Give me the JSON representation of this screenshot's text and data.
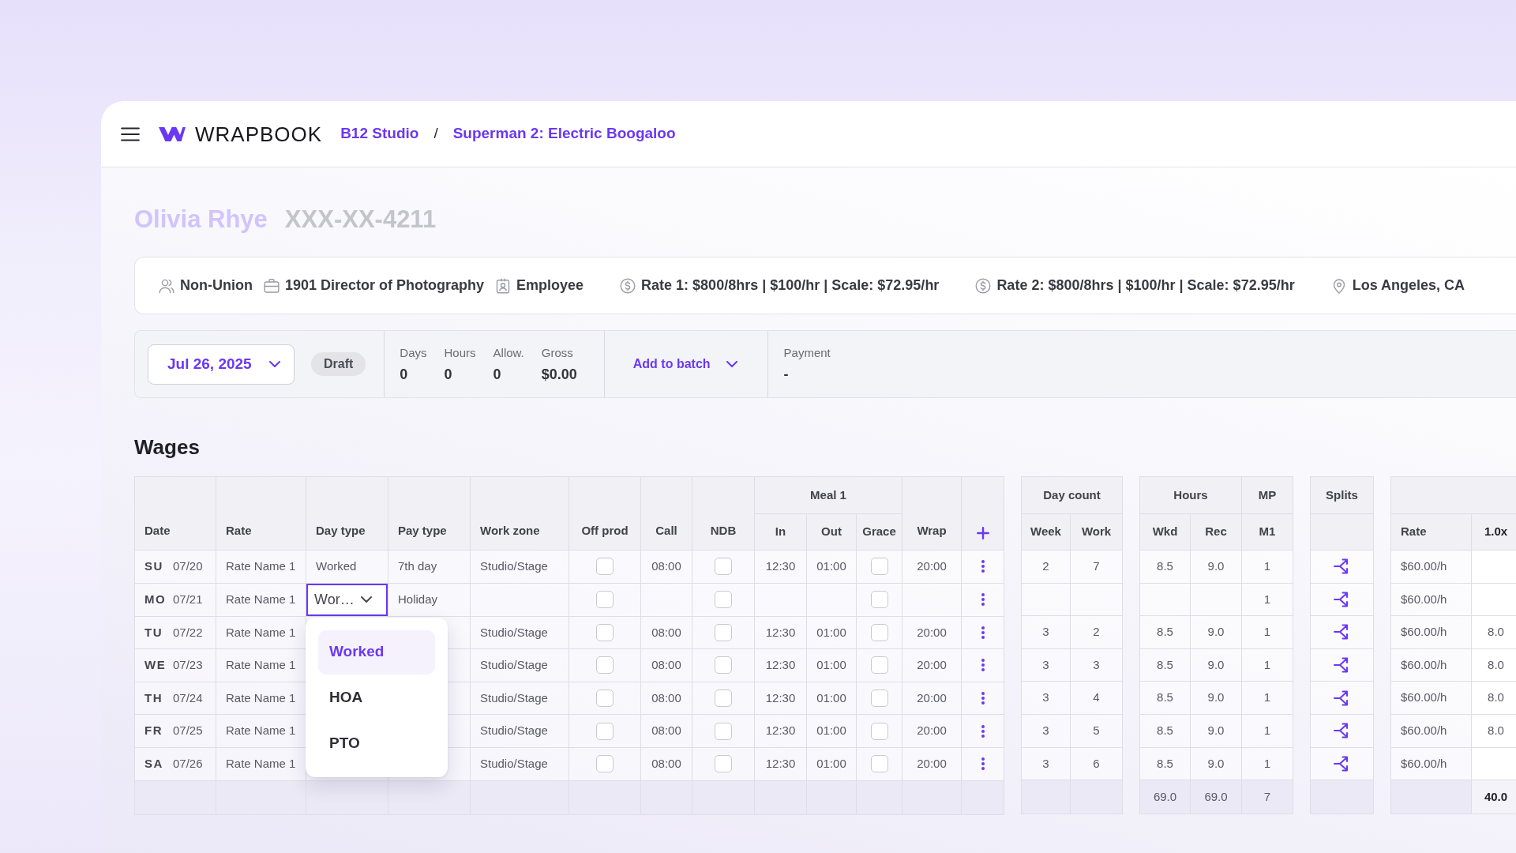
{
  "navbar": {
    "brand": "WRAPBOOK",
    "breadcrumbs": [
      {
        "label": "B12 Studio"
      },
      {
        "label": "Superman 2: Electric Boogaloo"
      }
    ],
    "separator": "/"
  },
  "employee": {
    "name": "Olivia Rhye",
    "ssn": "XXX-XX-4211"
  },
  "details": [
    {
      "kind": "union",
      "text": "Non-Union"
    },
    {
      "kind": "position",
      "text": "1901 Director of Photography"
    },
    {
      "kind": "worker_type",
      "text": "Employee"
    },
    {
      "kind": "rate",
      "text": "Rate 1: $800/8hrs | $100/hr | Scale: $72.95/hr"
    },
    {
      "kind": "rate",
      "text": "Rate 2: $800/8hrs | $100/hr | Scale: $72.95/hr"
    },
    {
      "kind": "location",
      "text": "Los Angeles, CA"
    }
  ],
  "timecard": {
    "date": "Jul 26, 2025",
    "status": "Draft",
    "stats": [
      {
        "label": "Days",
        "value": "0"
      },
      {
        "label": "Hours",
        "value": "0"
      },
      {
        "label": "Allow.",
        "value": "0"
      },
      {
        "label": "Gross",
        "value": "$0.00"
      }
    ],
    "batch_button": "Add to batch",
    "payment": {
      "label": "Payment",
      "value": "-"
    }
  },
  "wages": {
    "title": "Wages",
    "tables": [
      {
        "header": [
          {
            "kind": "date",
            "label": "Date"
          },
          {
            "kind": "text",
            "label": "Rate"
          },
          {
            "kind": "select",
            "label": "Day type"
          },
          {
            "kind": "text",
            "label": "Pay type"
          },
          {
            "kind": "text",
            "label": "Work zone"
          },
          {
            "kind": "checkbox",
            "label": "Off prod"
          },
          {
            "kind": "time",
            "label": "Call"
          },
          {
            "kind": "checkbox",
            "label": "NDB"
          },
          {
            "kind": "group",
            "label": "Meal 1",
            "columns": [
              {
                "kind": "time",
                "label": "In"
              },
              {
                "kind": "time",
                "label": "Out"
              },
              {
                "kind": "checkbox",
                "label": "Grace"
              }
            ]
          },
          {
            "kind": "time",
            "label": "Wrap"
          },
          {
            "kind": "actions"
          }
        ],
        "rows": [
          [
            {
              "day": "SU",
              "date": "07/20"
            },
            "Rate Name 1",
            {
              "value": "Worked",
              "open": false
            },
            "7th day",
            "Studio/Stage",
            {
              "checked": false
            },
            "08:00",
            {
              "checked": false
            },
            "12:30",
            "01:00",
            {
              "checked": false
            },
            "20:00",
            null
          ],
          [
            {
              "day": "MO",
              "date": "07/21"
            },
            "Rate Name 1",
            {
              "value": "Wor…",
              "open": true,
              "options": [
                {
                  "label": "Worked",
                  "selected": true
                },
                {
                  "label": "HOA",
                  "selected": false
                },
                {
                  "label": "PTO",
                  "selected": false
                }
              ]
            },
            "Holiday",
            null,
            {
              "checked": false
            },
            null,
            {
              "checked": false
            },
            null,
            null,
            {
              "checked": false
            },
            null,
            null
          ],
          [
            {
              "day": "TU",
              "date": "07/22"
            },
            "Rate Name 1",
            null,
            null,
            "Studio/Stage",
            {
              "checked": false
            },
            "08:00",
            {
              "checked": false
            },
            "12:30",
            "01:00",
            {
              "checked": false
            },
            "20:00",
            null
          ],
          [
            {
              "day": "WE",
              "date": "07/23"
            },
            "Rate Name 1",
            null,
            null,
            "Studio/Stage",
            {
              "checked": false
            },
            "08:00",
            {
              "checked": false
            },
            "12:30",
            "01:00",
            {
              "checked": false
            },
            "20:00",
            null
          ],
          [
            {
              "day": "TH",
              "date": "07/24"
            },
            "Rate Name 1",
            null,
            null,
            "Studio/Stage",
            {
              "checked": false
            },
            "08:00",
            {
              "checked": false
            },
            "12:30",
            "01:00",
            {
              "checked": false
            },
            "20:00",
            null
          ],
          [
            {
              "day": "FR",
              "date": "07/25"
            },
            "Rate Name 1",
            null,
            null,
            "Studio/Stage",
            {
              "checked": false
            },
            "08:00",
            {
              "checked": false
            },
            "12:30",
            "01:00",
            {
              "checked": false
            },
            "20:00",
            null
          ],
          [
            {
              "day": "SA",
              "date": "07/26"
            },
            "Rate Name 1",
            null,
            null,
            "Studio/Stage",
            {
              "checked": false
            },
            "08:00",
            {
              "checked": false
            },
            "12:30",
            "01:00",
            {
              "checked": false
            },
            "20:00",
            null
          ]
        ]
      },
      {
        "header": [
          {
            "kind": "group",
            "label": "Day count",
            "columns": [
              {
                "kind": "number",
                "label": "Week"
              },
              {
                "kind": "number",
                "label": "Work"
              }
            ]
          }
        ],
        "rows": [
          [
            "2",
            "7"
          ],
          [
            null,
            null
          ],
          [
            "3",
            "2"
          ],
          [
            "3",
            "3"
          ],
          [
            "3",
            "4"
          ],
          [
            "3",
            "5"
          ],
          [
            "3",
            "6"
          ]
        ]
      },
      {
        "header": [
          {
            "kind": "group",
            "label": "Hours",
            "columns": [
              {
                "kind": "number",
                "label": "Wkd",
                "total": "69.0"
              },
              {
                "kind": "number",
                "label": "Rec",
                "total": "69.0"
              }
            ]
          },
          {
            "kind": "group",
            "label": "MP",
            "columns": [
              {
                "kind": "number",
                "label": "M1",
                "total": "7"
              }
            ]
          }
        ],
        "rows": [
          [
            "8.5",
            "9.0",
            "1"
          ],
          [
            null,
            null,
            "1"
          ],
          [
            "8.5",
            "9.0",
            "1"
          ],
          [
            "8.5",
            "9.0",
            "1"
          ],
          [
            "8.5",
            "9.0",
            "1"
          ],
          [
            "8.5",
            "9.0",
            "1"
          ],
          [
            "8.5",
            "9.0",
            "1"
          ]
        ]
      },
      {
        "header": [
          {
            "kind": "group",
            "label": "Splits",
            "columns": [
              {
                "kind": "split"
              }
            ]
          }
        ],
        "rows": [
          [
            null
          ],
          [
            null
          ],
          [
            null
          ],
          [
            null
          ],
          [
            null
          ],
          [
            null
          ],
          [
            null
          ]
        ]
      },
      {
        "header": [
          {
            "kind": "group",
            "columns": [
              {
                "kind": "text",
                "label": "Rate",
                "highlighted": false
              },
              {
                "kind": "number",
                "label": "1.0x",
                "highlighted": true,
                "total": "40.0"
              }
            ]
          }
        ],
        "rows": [
          [
            "$60.00/h",
            null
          ],
          [
            "$60.00/h",
            null
          ],
          [
            "$60.00/h",
            "8.0"
          ],
          [
            "$60.00/h",
            "8.0"
          ],
          [
            "$60.00/h",
            "8.0"
          ],
          [
            "$60.00/h",
            "8.0"
          ],
          [
            "$60.00/h",
            null
          ]
        ]
      }
    ]
  }
}
